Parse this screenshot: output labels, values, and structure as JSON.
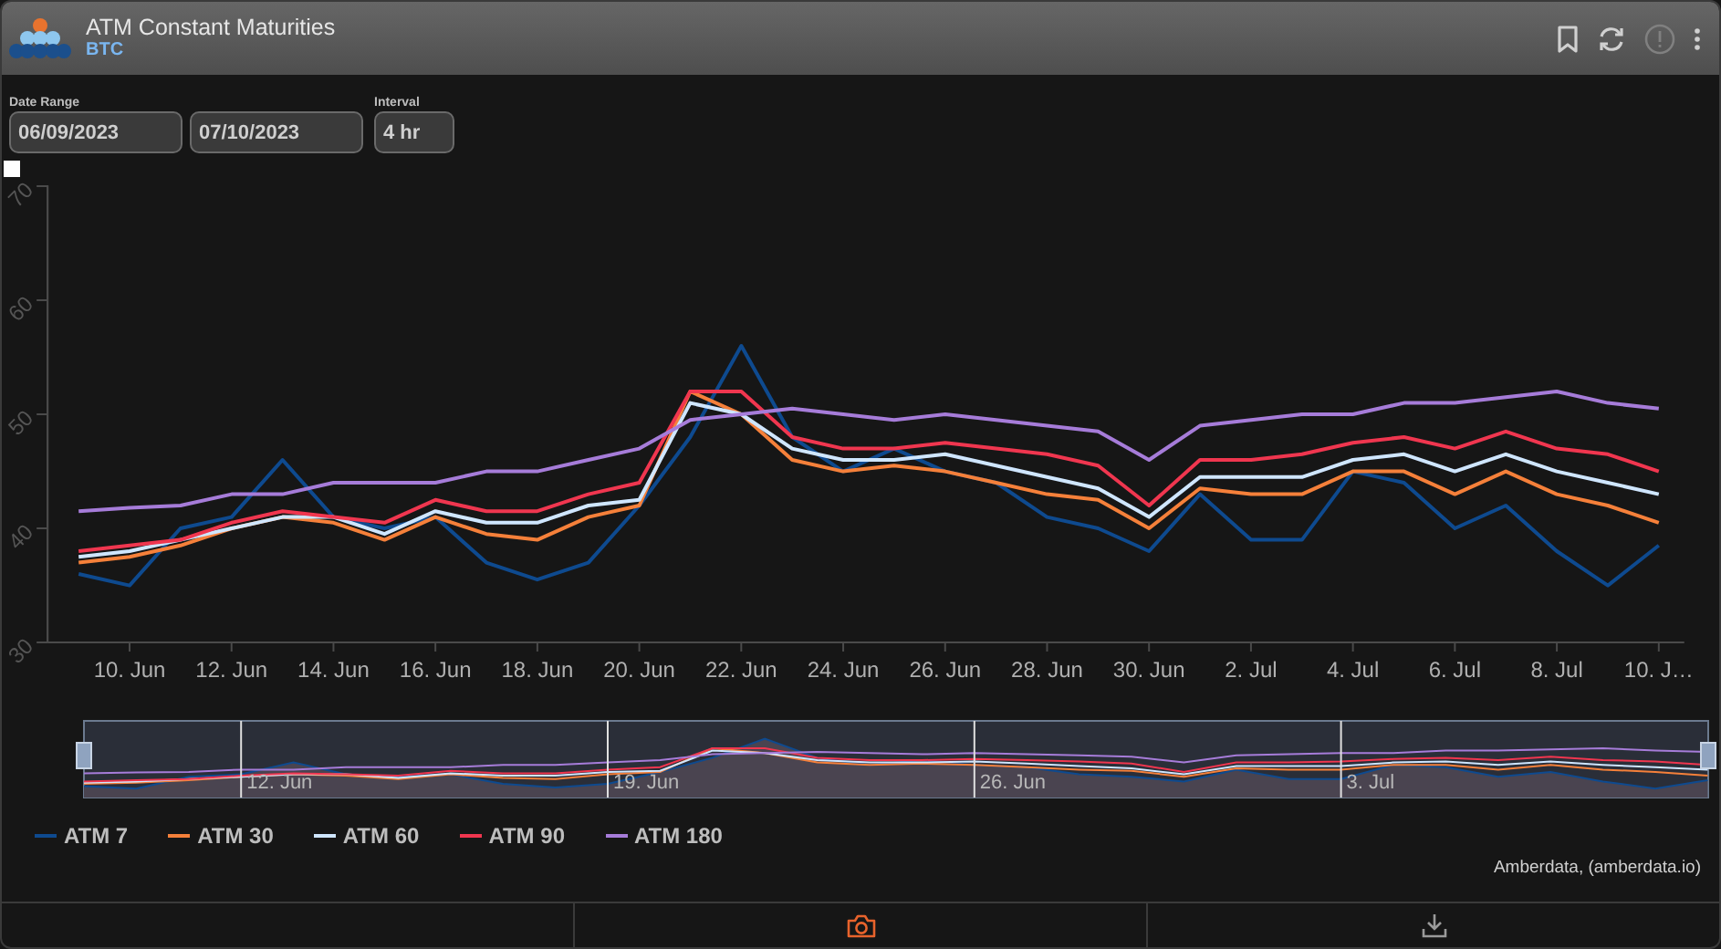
{
  "header": {
    "title": "ATM Constant Maturities",
    "subtitle": "BTC"
  },
  "date_range": {
    "label": "Date Range",
    "start": "06/09/2023",
    "end": "07/10/2023"
  },
  "interval": {
    "label": "Interval",
    "value": "4 hr"
  },
  "chart_data": {
    "type": "line",
    "categories": [
      null,
      "10. Jun",
      null,
      "12. Jun",
      null,
      "14. Jun",
      null,
      "16. Jun",
      null,
      "18. Jun",
      null,
      "20. Jun",
      null,
      "22. Jun",
      null,
      "24. Jun",
      null,
      "26. Jun",
      null,
      "28. Jun",
      null,
      "30. Jun",
      null,
      "2. Jul",
      null,
      "4. Jul",
      null,
      "6. Jul",
      null,
      "8. Jul",
      null,
      "10. J…"
    ],
    "ylim": [
      30,
      70
    ],
    "yticks": [
      30,
      40,
      50,
      60,
      70
    ],
    "series": [
      {
        "name": "ATM 7",
        "color": "#0e4a8f",
        "values": [
          36,
          35,
          40,
          41,
          46,
          41,
          40,
          41,
          37,
          35.5,
          37,
          42,
          48,
          56,
          48,
          45,
          47,
          45,
          44,
          41,
          40,
          38,
          43,
          39,
          39,
          45,
          44,
          40,
          42,
          38,
          35,
          38.5
        ]
      },
      {
        "name": "ATM 30",
        "color": "#f5803a",
        "values": [
          37,
          37.5,
          38.5,
          40,
          41,
          40.5,
          39,
          41,
          39.5,
          39,
          41,
          42,
          52,
          50,
          46,
          45,
          45.5,
          45,
          44,
          43,
          42.5,
          40,
          43.5,
          43,
          43,
          45,
          45,
          43,
          45,
          43,
          42,
          40.5
        ]
      },
      {
        "name": "ATM 60",
        "color": "#cfe6ff",
        "values": [
          37.5,
          38,
          39,
          40,
          41,
          41,
          39.5,
          41.5,
          40.5,
          40.5,
          42,
          42.5,
          51,
          50,
          47,
          46,
          46,
          46.5,
          45.5,
          44.5,
          43.5,
          41,
          44.5,
          44.5,
          44.5,
          46,
          46.5,
          45,
          46.5,
          45,
          44,
          43
        ]
      },
      {
        "name": "ATM 90",
        "color": "#f0364f",
        "values": [
          38,
          38.5,
          39,
          40.5,
          41.5,
          41,
          40.5,
          42.5,
          41.5,
          41.5,
          43,
          44,
          52,
          52,
          48,
          47,
          47,
          47.5,
          47,
          46.5,
          45.5,
          42,
          46,
          46,
          46.5,
          47.5,
          48,
          47,
          48.5,
          47,
          46.5,
          45
        ]
      },
      {
        "name": "ATM 180",
        "color": "#a67cd9",
        "values": [
          41.5,
          41.8,
          42,
          43,
          43,
          44,
          44,
          44,
          45,
          45,
          46,
          47,
          49.5,
          50,
          50.5,
          50,
          49.5,
          50,
          49.5,
          49,
          48.5,
          46,
          49,
          49.5,
          50,
          50,
          51,
          51,
          51.5,
          52,
          51,
          50.5
        ]
      }
    ]
  },
  "navigator": {
    "labels": [
      "12. Jun",
      "19. Jun",
      "26. Jun",
      "3. Jul"
    ]
  },
  "credits": "Amberdata, (amberdata.io)"
}
